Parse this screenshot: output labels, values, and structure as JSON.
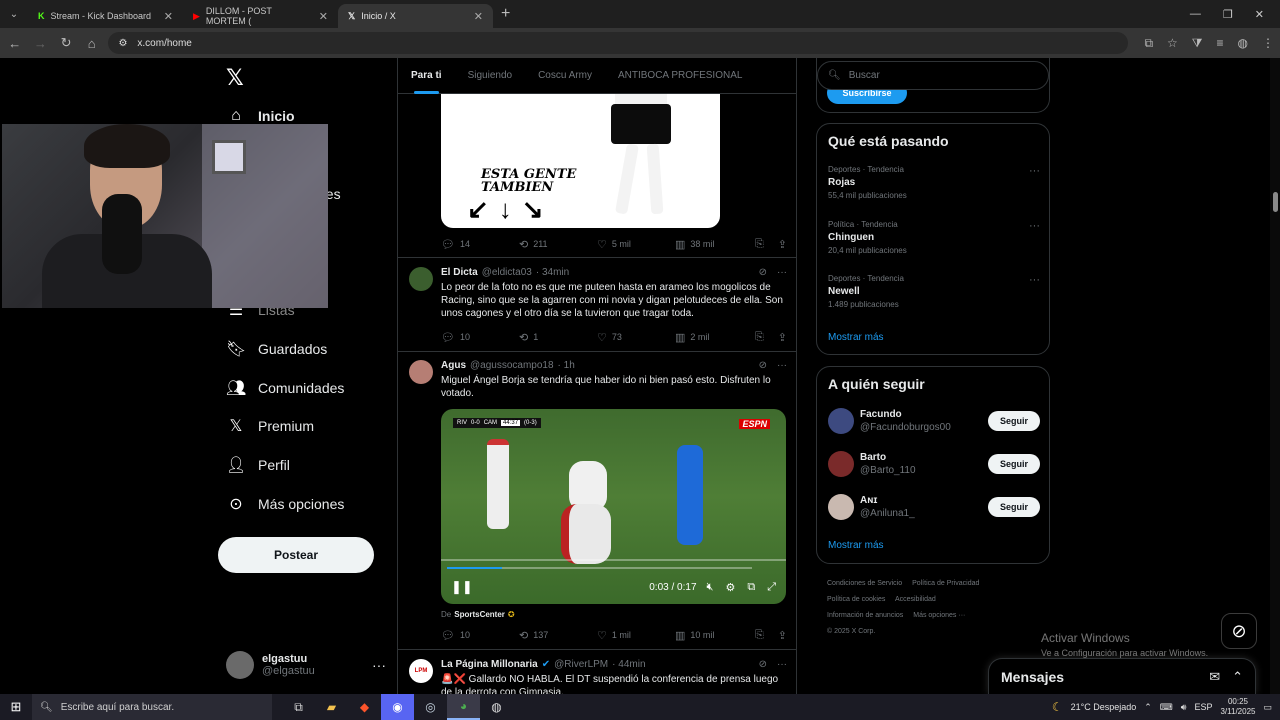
{
  "browser": {
    "tabs": [
      {
        "label": "Stream - Kick Dashboard",
        "icon": "kick-icon",
        "active": false
      },
      {
        "label": "DILLOM - POST MORTEM (",
        "icon": "youtube-icon",
        "active": false
      },
      {
        "label": "Inicio / X",
        "icon": "x-icon",
        "active": true
      }
    ],
    "url": "x.com/home"
  },
  "nav": {
    "items": [
      {
        "label": "Inicio",
        "icon": "home-icon"
      },
      {
        "label": "nes",
        "icon": "notifications-icon"
      },
      {
        "label": "Listas",
        "icon": "lists-icon"
      },
      {
        "label": "Guardados",
        "icon": "bookmark-icon"
      },
      {
        "label": "Comunidades",
        "icon": "communities-icon"
      },
      {
        "label": "Premium",
        "icon": "x-premium-icon"
      },
      {
        "label": "Perfil",
        "icon": "profile-icon"
      },
      {
        "label": "Más opciones",
        "icon": "more-icon"
      }
    ],
    "post_label": "Postear",
    "account": {
      "name": "elgastuu",
      "handle": "@elgastuu"
    }
  },
  "timeline": {
    "tabs": [
      "Para ti",
      "Siguiendo",
      "Coscu Army",
      "ANTIBOCA PROFESIONAL"
    ],
    "image1_text": [
      "ESTA GENTE",
      "TAMBIEN"
    ],
    "post1_stats": {
      "replies": "14",
      "reposts": "211",
      "likes": "5 mil",
      "views": "38 mil"
    },
    "post2": {
      "name": "El Dicta",
      "handle": "@eldicta03",
      "time": "· 34min",
      "text": "Lo peor de la foto no es que me puteen hasta en arameo los mogolicos de Racing, sino que se la agarren con mi novia y digan pelotudeces de ella. Son unos cagones y el otro día se la tuvieron que tragar toda.",
      "stats": {
        "replies": "10",
        "reposts": "1",
        "likes": "73",
        "views": "2 mil"
      }
    },
    "post3": {
      "name": "Agus",
      "handle": "@agussocampo18",
      "time": "· 1h",
      "text": "Miguel Ángel Borja se tendría que haber ido ni bien pasó esto. Disfruten lo votado.",
      "video": {
        "score_left": "RIV",
        "score": "0-0",
        "score_right": "CAM",
        "clock": "44:37",
        "agg": "(0-3)",
        "brand": "ESPN",
        "time": "0:03 / 0:17",
        "progress": 0.18
      },
      "from_label": "De",
      "from_source": "SportsCenter",
      "stats": {
        "replies": "10",
        "reposts": "137",
        "likes": "1 mil",
        "views": "10 mil"
      }
    },
    "post4": {
      "name": "La Página Millonaria",
      "handle": "@RiverLPM",
      "time": "· 44min",
      "text": "🚨❌ Gallardo NO HABLA. El DT suspendió la conferencia de prensa luego de la derrota con Gimnasia."
    }
  },
  "right": {
    "search_placeholder": "Buscar",
    "subscribe_label": "Suscribirse",
    "trends_title": "Qué está pasando",
    "trends": [
      {
        "category": "Deportes · Tendencia",
        "name": "Rojas",
        "count": "55,4 mil publicaciones"
      },
      {
        "category": "Política · Tendencia",
        "name": "Chinguen",
        "count": "20,4 mil publicaciones"
      },
      {
        "category": "Deportes · Tendencia",
        "name": "Newell",
        "count": "1.489 publicaciones"
      }
    ],
    "show_more": "Mostrar más",
    "follow_title": "A quién seguir",
    "follow": [
      {
        "name": "Facundo",
        "handle": "@Facundoburgos00"
      },
      {
        "name": "Barto",
        "handle": "@Barto_110"
      },
      {
        "name": "Aɴɪ",
        "handle": "@Aniluna1_"
      }
    ],
    "follow_label": "Seguir",
    "footer": [
      "Condiciones de Servicio",
      "Política de Privacidad",
      "Política de cookies",
      "Accesibilidad",
      "Información de anuncios",
      "Más opciones ···",
      "© 2025 X Corp."
    ]
  },
  "overlay": {
    "activate_title": "Activar Windows",
    "activate_sub": "Ve a Configuración para activar Windows.",
    "messages": "Mensajes"
  },
  "taskbar": {
    "search_placeholder": "Escribe aquí para buscar.",
    "weather": "21°C  Despejado",
    "lang": "ESP",
    "time": "00:25",
    "date": "3/11/2025"
  }
}
